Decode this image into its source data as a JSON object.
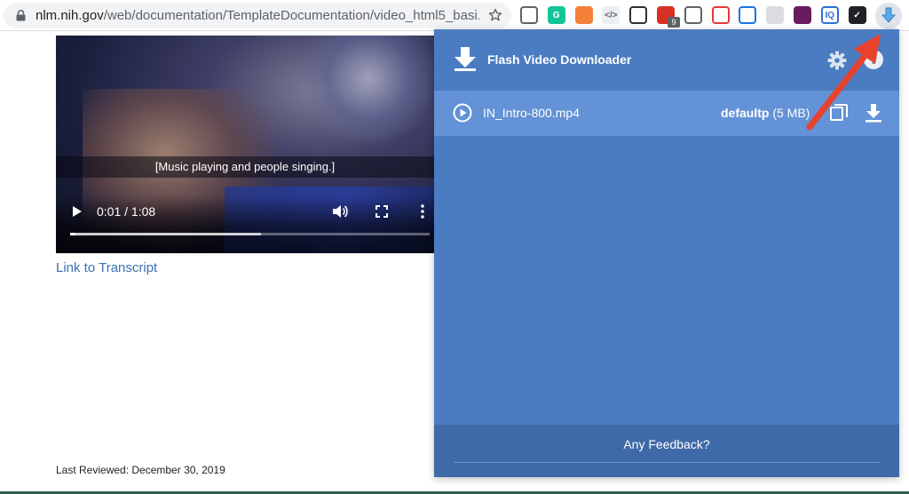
{
  "browser": {
    "url_host": "nlm.nih.gov",
    "url_path": "/web/documentation/TemplateDocumentation/video_html5_basi...",
    "extension_badge": "9",
    "extensions": [
      {
        "name": "privacy-shield-extension-icon",
        "label": "",
        "bg": "#ffffff",
        "fg": "#5f6368"
      },
      {
        "name": "grammarly-extension-icon",
        "label": "G",
        "bg": "#15c39a",
        "fg": "#ffffff"
      },
      {
        "name": "chart-extension-icon",
        "label": "",
        "bg": "#f4803a",
        "fg": "#ffffff"
      },
      {
        "name": "code-extension-icon",
        "label": "</>",
        "bg": "#eceff1",
        "fg": "#5f6368"
      },
      {
        "name": "leaf-extension-icon",
        "label": "",
        "bg": "#ffffff",
        "fg": "#303134"
      },
      {
        "name": "red-extension-icon",
        "label": "",
        "bg": "#d93025",
        "fg": "#ffffff"
      },
      {
        "name": "puzzle-extension-icon",
        "label": "",
        "bg": "#ffffff",
        "fg": "#5f6368"
      },
      {
        "name": "multicolor-extension-icon",
        "label": "",
        "bg": "#ffffff",
        "fg": "#e53935"
      },
      {
        "name": "send-extension-icon",
        "label": "",
        "bg": "#ffffff",
        "fg": "#1a73e8"
      },
      {
        "name": "text-extension-icon",
        "label": "",
        "bg": "#dadce0",
        "fg": "#5f6368"
      },
      {
        "name": "purple-chart-extension-icon",
        "label": "",
        "bg": "#6a1b5f",
        "fg": "#ffffff"
      },
      {
        "name": "iq-extension-icon",
        "label": "IQ",
        "bg": "#ffffff",
        "fg": "#2e6fd8"
      },
      {
        "name": "checkmark-extension-icon",
        "label": "✓",
        "bg": "#202124",
        "fg": "#ffffff"
      }
    ]
  },
  "video": {
    "caption": "[Music playing and people singing.]",
    "current_time": "0:01",
    "duration": "1:08",
    "time_display": "0:01 / 1:08",
    "played_fraction": 0.015,
    "buffered_fraction": 0.53
  },
  "page": {
    "transcript_link": "Link to Transcript",
    "last_reviewed": "Last Reviewed: December 30, 2019"
  },
  "popup": {
    "title": "Flash Video Downloader",
    "help_label": "?",
    "video_item": {
      "file_name": "IN_Intro-800.mp4",
      "quality": "defaultp",
      "size": "(5 MB)"
    },
    "feedback": "Any Feedback?",
    "colors": {
      "background": "#4b7cc1",
      "row": "#6392d6",
      "footer": "#3f6aa8"
    }
  },
  "annotation": {
    "arrow_color": "#e8412c"
  }
}
